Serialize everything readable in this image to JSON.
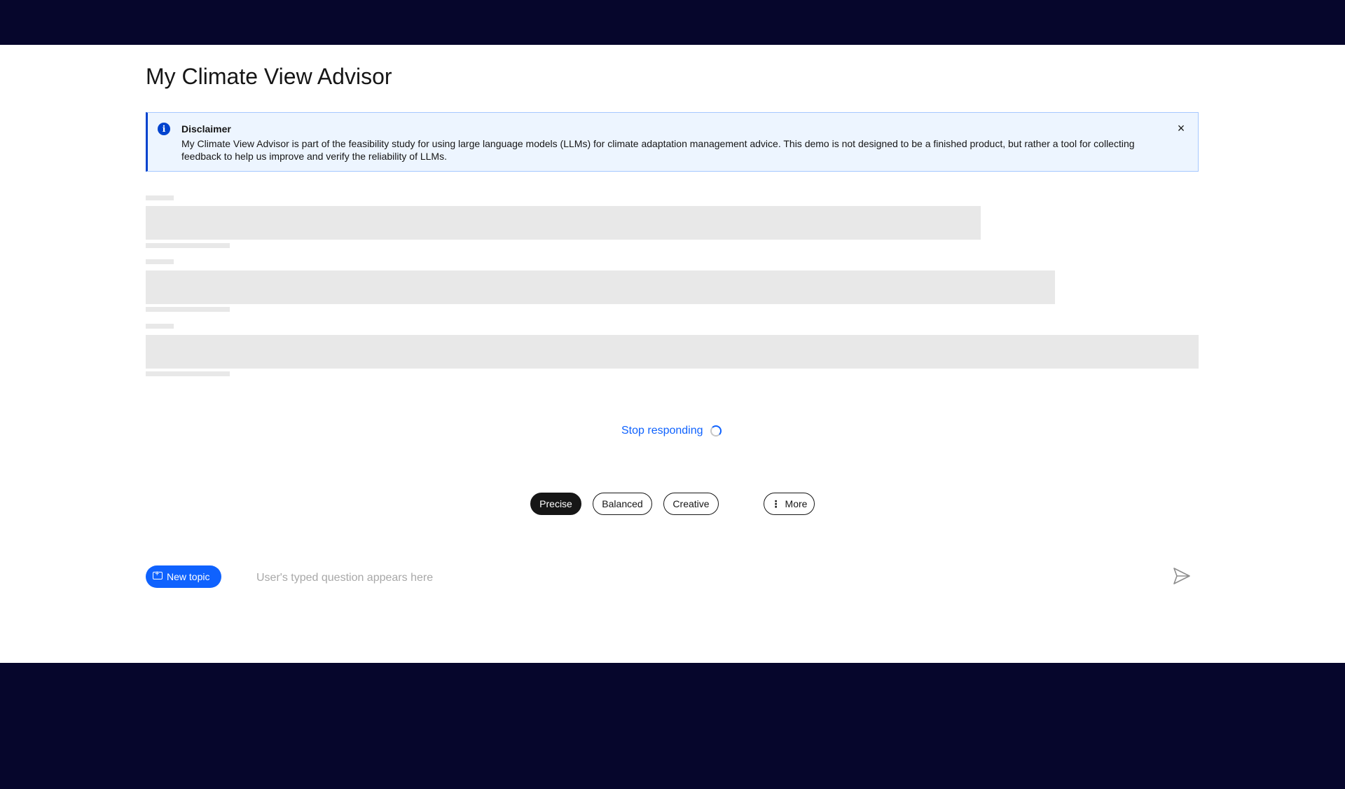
{
  "header": {
    "title": "My Climate View Advisor"
  },
  "disclaimer": {
    "title": "Disclaimer",
    "body": "My Climate View Advisor is part of the feasibility study for using large language models (LLMs) for climate adaptation management advice. This demo is not designed to be a finished product, but rather a tool for collecting feedback to help us improve and verify the reliability of LLMs.",
    "close_glyph": "×",
    "info_glyph": "i"
  },
  "loading": {
    "stop_label": "Stop responding"
  },
  "modes": {
    "items": [
      {
        "label": "Precise",
        "active": true
      },
      {
        "label": "Balanced",
        "active": false
      },
      {
        "label": "Creative",
        "active": false
      }
    ],
    "more_label": "More",
    "more_glyph": "⋮"
  },
  "composer": {
    "new_topic_label": "New topic",
    "input_placeholder": "User's typed question appears here",
    "input_value": ""
  },
  "colors": {
    "accent": "#0f62fe",
    "band": "#06062c",
    "notification_bg": "#edf5ff"
  }
}
